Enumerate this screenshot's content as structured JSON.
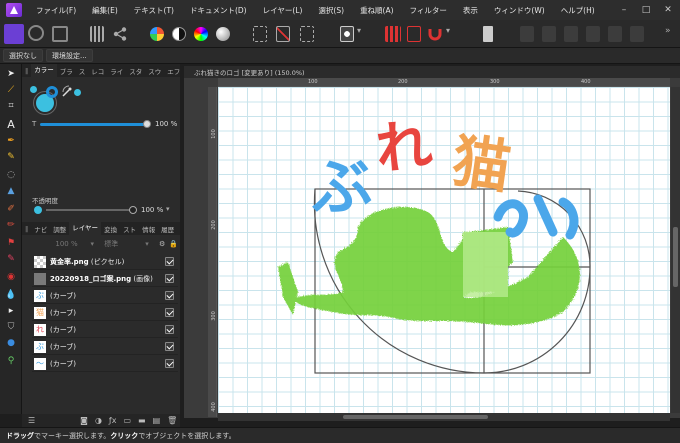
{
  "menu": [
    "ファイル(F)",
    "編集(E)",
    "テキスト(T)",
    "ドキュメント(D)",
    "レイヤー(L)",
    "選択(S)",
    "重ね順(A)",
    "フィルター",
    "表示",
    "ウィンドウ(W)",
    "ヘルプ(H)"
  ],
  "context": {
    "deselect": "選択なし",
    "env": "環境設定..."
  },
  "panel_tabs": [
    "カラー",
    "ブラ",
    "ス",
    "レコ",
    "ライ",
    "スタ",
    "スウ",
    "エフ",
    "≡"
  ],
  "color": {
    "primary": "#3cc0e0",
    "secondary": "#1f8fd8",
    "opacity_pct": "100 %",
    "opacity_label": "不透明度",
    "opacity2_pct": "100 %"
  },
  "layer_tabs": [
    "ナビ",
    "調整",
    "レイヤー",
    "変換",
    "スト",
    "情報",
    "履歴"
  ],
  "layer_controls": {
    "opacity": "100 %",
    "blend": "標準"
  },
  "layers": [
    {
      "name": "黄金率.png",
      "type": "(ピクセル)"
    },
    {
      "name": "20220918_ロゴ案.png",
      "type": "(画像)"
    },
    {
      "name": "",
      "type": "(カーブ)"
    },
    {
      "name": "",
      "type": "(カーブ)"
    },
    {
      "name": "",
      "type": "(カーブ)"
    },
    {
      "name": "",
      "type": "(カーブ)"
    },
    {
      "name": "",
      "type": "(カーブ)"
    }
  ],
  "document": {
    "tab_title": "ぶれ猫きのロゴ [変更あり] (150.0%)"
  },
  "ruler": {
    "h": [
      "100",
      "200",
      "300",
      "400"
    ],
    "v": [
      "100",
      "200",
      "300",
      "400"
    ]
  },
  "logo_text": {
    "c1": "ぶ",
    "c2": "れ",
    "c3": "猫"
  },
  "status": {
    "drag": "ドラッグ",
    "drag_desc": "でマーキー選択します。",
    "click": "クリック",
    "click_desc": "でオブジェクトを選択します。"
  }
}
